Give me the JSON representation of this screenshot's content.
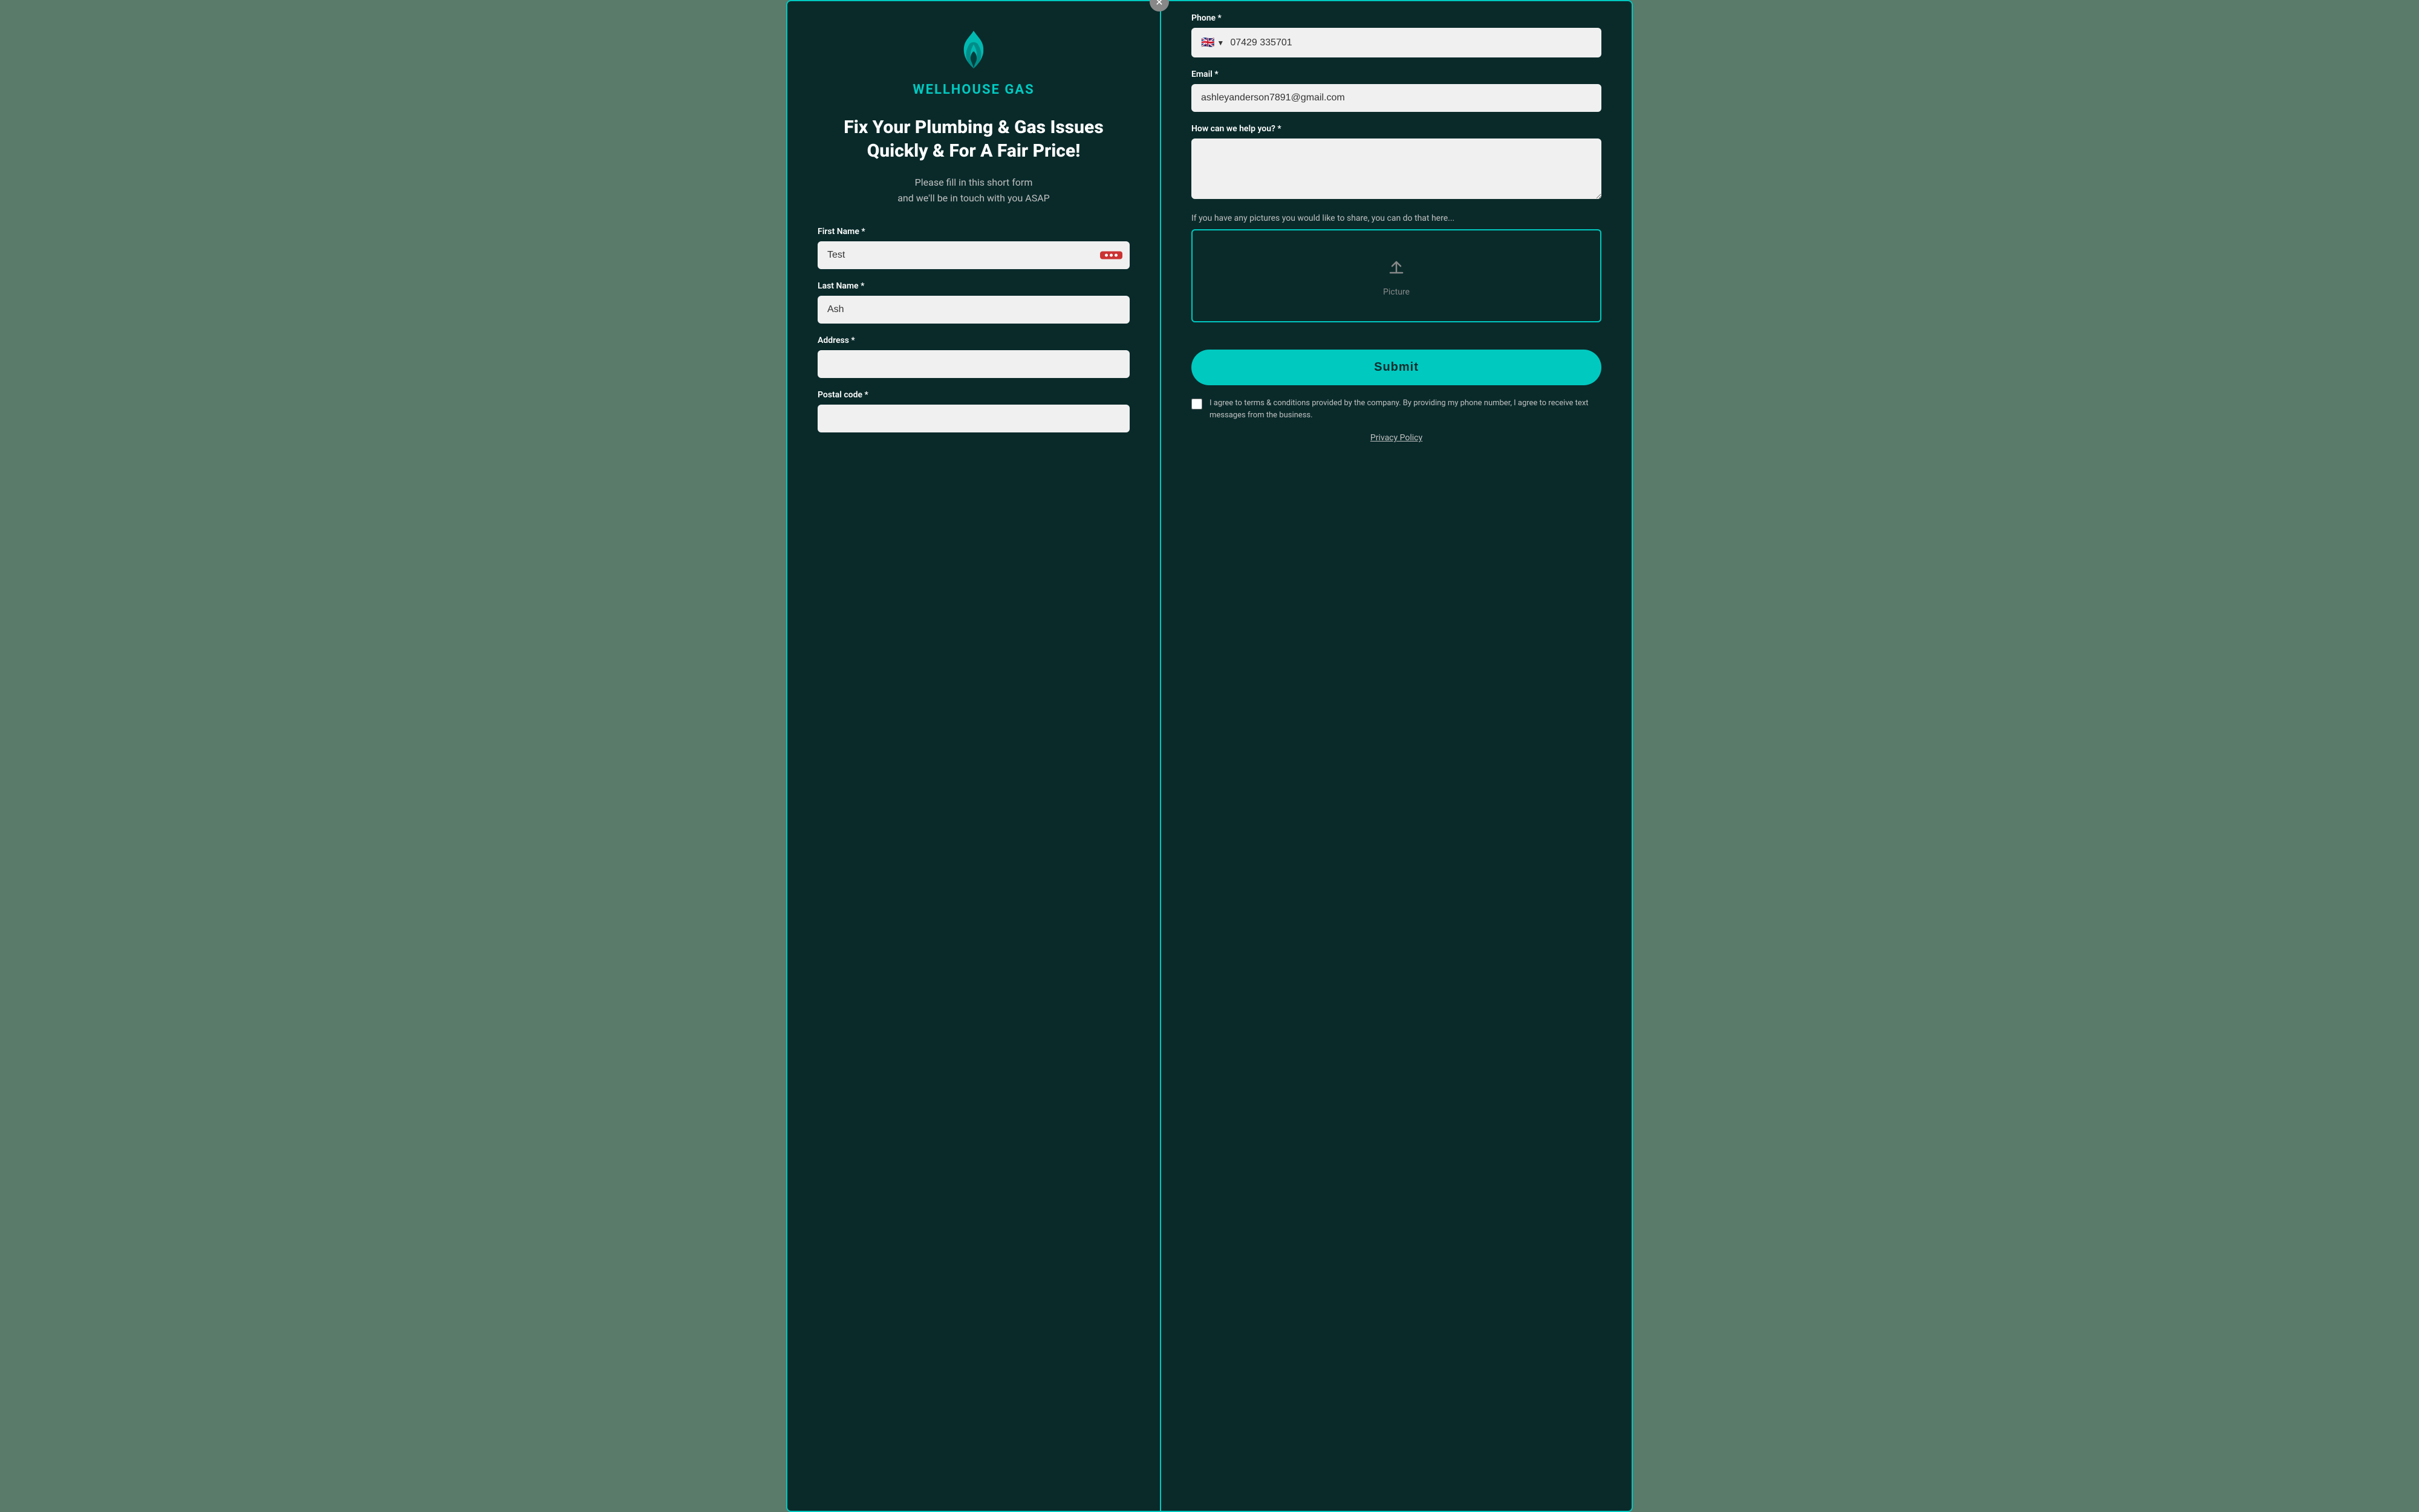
{
  "brand": {
    "name": "WELLHOUSE GAS"
  },
  "hero": {
    "title": "Fix Your Plumbing & Gas Issues Quickly & For A Fair Price!",
    "subtitle_line1": "Please fill in this short form",
    "subtitle_line2": "and we'll be in touch with you ASAP"
  },
  "form": {
    "left": {
      "first_name_label": "First Name *",
      "first_name_value": "Test",
      "last_name_label": "Last Name *",
      "last_name_value": "Ash",
      "address_label": "Address *",
      "address_value": "",
      "postal_code_label": "Postal code *",
      "postal_code_value": ""
    },
    "right": {
      "phone_label": "Phone *",
      "phone_flag": "🇬🇧",
      "phone_value": "07429 335701",
      "email_label": "Email *",
      "email_value": "ashleyanderson7891@gmail.com",
      "help_label": "How can we help you? *",
      "help_value": "",
      "picture_label": "If you have any pictures you would like to share, you can do that here...",
      "upload_text": "Picture",
      "submit_label": "Submit",
      "terms_text": "I agree to terms & conditions provided by the company. By providing my phone number, I agree to receive text messages from the business.",
      "privacy_label": "Privacy Policy"
    }
  },
  "icons": {
    "close": "✕",
    "upload": "⬆",
    "dropdown_arrow": "▼"
  }
}
